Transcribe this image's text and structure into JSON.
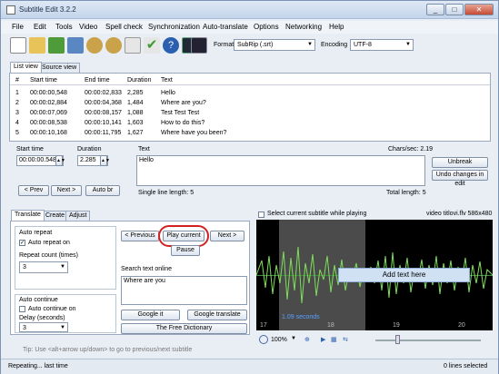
{
  "window": {
    "title": "Subtitle Edit 3.2.2"
  },
  "menu": [
    "File",
    "Edit",
    "Tools",
    "Video",
    "Spell check",
    "Synchronization",
    "Auto-translate",
    "Options",
    "Networking",
    "Help"
  ],
  "toolbar": {
    "format_label": "Format",
    "format_value": "SubRip (.srt)",
    "encoding_label": "Encoding",
    "encoding_value": "UTF-8"
  },
  "view_tabs": [
    "List view",
    "Source view"
  ],
  "table": {
    "headers": [
      "#",
      "Start time",
      "End time",
      "Duration",
      "Text"
    ],
    "rows": [
      [
        "1",
        "00:00:00,548",
        "00:00:02,833",
        "2,285",
        "Hello"
      ],
      [
        "2",
        "00:00:02,884",
        "00:00:04,368",
        "1,484",
        "Where are you?"
      ],
      [
        "3",
        "00:00:07,069",
        "00:00:08,157",
        "1,088",
        "Test Test Test"
      ],
      [
        "4",
        "00:00:08,538",
        "00:00:10,141",
        "1,603",
        "How to do this?"
      ],
      [
        "5",
        "00:00:10,168",
        "00:00:11,795",
        "1,627",
        "Where have you been?"
      ]
    ]
  },
  "edit": {
    "start_label": "Start time",
    "start_value": "00:00:00.548",
    "duration_label": "Duration",
    "duration_value": "2.285",
    "text_label": "Text",
    "chars_sec": "Chars/sec: 2.19",
    "text_value": "Hello",
    "prev": "< Prev",
    "next": "Next >",
    "auto_br": "Auto br",
    "unbreak": "Unbreak",
    "undo": "Undo changes in edit",
    "single_line": "Single line length: 5",
    "total_length": "Total length: 5"
  },
  "lower_tabs": [
    "Translate",
    "Create",
    "Adjust"
  ],
  "translate": {
    "auto_repeat": "Auto repeat",
    "auto_repeat_on": "Auto repeat on",
    "repeat_count_label": "Repeat count (times)",
    "repeat_count": "3",
    "auto_continue": "Auto continue",
    "auto_continue_on": "Auto continue on",
    "delay_label": "Delay (seconds)",
    "delay": "3",
    "previous": "< Previous",
    "play_current": "Play current",
    "next": "Next >",
    "pause": "Pause",
    "search_label": "Search text online",
    "search_value": "Where are you",
    "google_it": "Google it",
    "google_translate": "Google translate",
    "free_dictionary": "The Free Dictionary",
    "tip": "Tip: Use <alt+arrow up/down> to go to previous/next subtitle"
  },
  "video": {
    "select_current": "Select current subtitle while playing",
    "file": "video titlovi.flv 586x480",
    "add_text": "Add text here",
    "seconds": "1.09 seconds",
    "ticks": [
      "17",
      "18",
      "19",
      "20"
    ],
    "zoom": "100%"
  },
  "status": {
    "left": "Repeating... last time",
    "right": "0 lines selected"
  },
  "colors": {
    "accent": "#1d4a8a",
    "wave": "#7fe05a",
    "highlight_ring": "#d32121"
  }
}
